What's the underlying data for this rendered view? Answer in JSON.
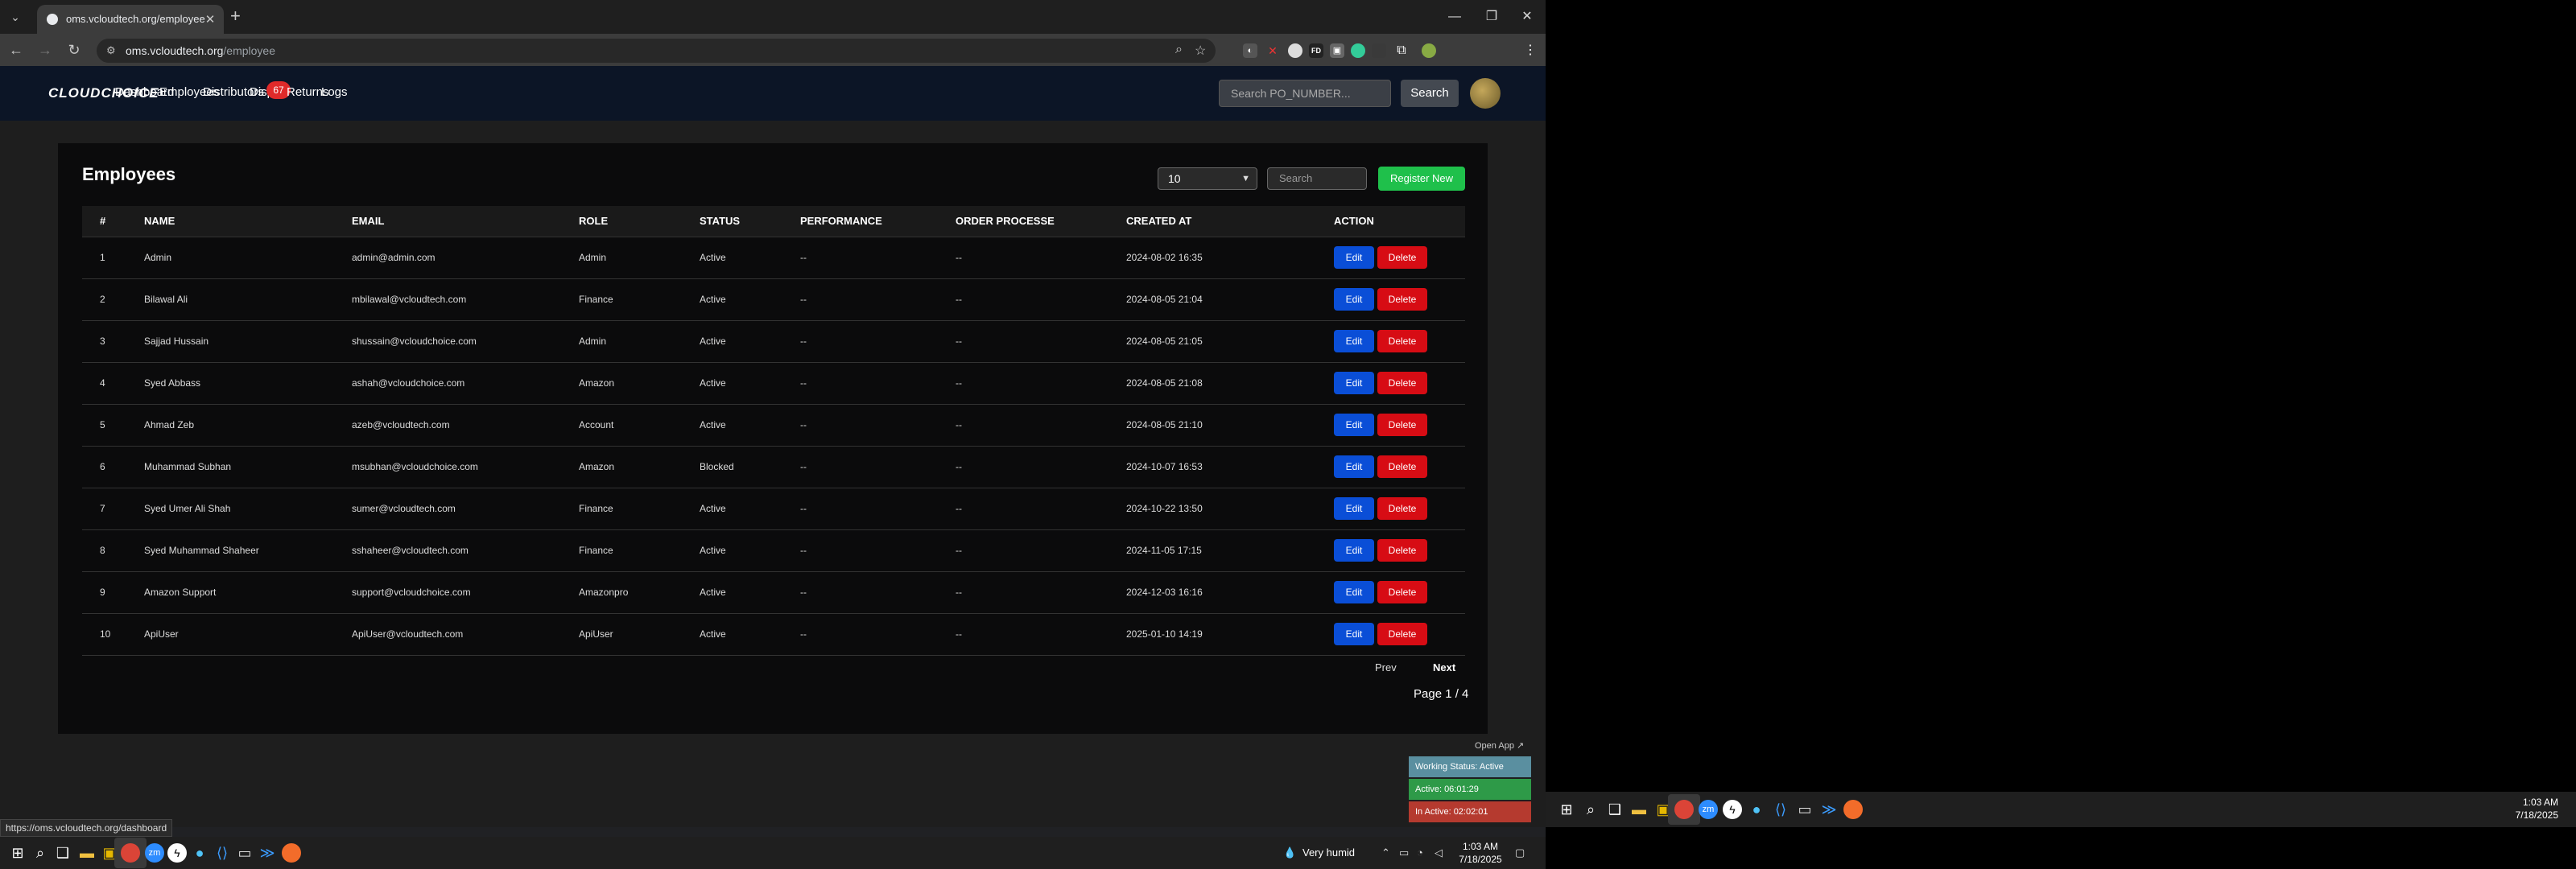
{
  "browser": {
    "tab_title": "oms.vcloudtech.org/employee",
    "url_host": "oms.vcloudtech.org",
    "url_path": "/employee",
    "status_url": "https://oms.vcloudtech.org/dashboard"
  },
  "site_nav": {
    "brand": "CLOUDCHOICE",
    "links": [
      "Dashboard",
      "Employees",
      "Distributors",
      "Dispu",
      "Returns",
      "Logs"
    ],
    "disputes_badge": "67",
    "search_placeholder": "Search PO_NUMBER...",
    "search_button": "Search"
  },
  "employees_page": {
    "title": "Employees",
    "page_size": "10",
    "search_placeholder": "Search",
    "register_button": "Register New",
    "columns": [
      "#",
      "NAME",
      "EMAIL",
      "ROLE",
      "STATUS",
      "PERFORMANCE",
      "ORDER PROCESSE",
      "CREATED AT",
      "ACTION"
    ],
    "edit_label": "Edit",
    "delete_label": "Delete",
    "rows": [
      [
        "1",
        "Admin",
        "admin@admin.com",
        "Admin",
        "Active",
        "--",
        "--",
        "2024-08-02 16:35"
      ],
      [
        "2",
        "Bilawal Ali",
        "mbilawal@vcloudtech.com",
        "Finance",
        "Active",
        "--",
        "--",
        "2024-08-05 21:04"
      ],
      [
        "3",
        "Sajjad Hussain",
        "shussain@vcloudchoice.com",
        "Admin",
        "Active",
        "--",
        "--",
        "2024-08-05 21:05"
      ],
      [
        "4",
        "Syed Abbass",
        "ashah@vcloudchoice.com",
        "Amazon",
        "Active",
        "--",
        "--",
        "2024-08-05 21:08"
      ],
      [
        "5",
        "Ahmad Zeb",
        "azeb@vcloudtech.com",
        "Account",
        "Active",
        "--",
        "--",
        "2024-08-05 21:10"
      ],
      [
        "6",
        "Muhammad Subhan",
        "msubhan@vcloudchoice.com",
        "Amazon",
        "Blocked",
        "--",
        "--",
        "2024-10-07 16:53"
      ],
      [
        "7",
        "Syed Umer Ali Shah",
        "sumer@vcloudtech.com",
        "Finance",
        "Active",
        "--",
        "--",
        "2024-10-22 13:50"
      ],
      [
        "8",
        "Syed Muhammad Shaheer",
        "sshaheer@vcloudtech.com",
        "Finance",
        "Active",
        "--",
        "--",
        "2024-11-05 17:15"
      ],
      [
        "9",
        "Amazon Support",
        "support@vcloudchoice.com",
        "Amazonpro",
        "Active",
        "--",
        "--",
        "2024-12-03 16:16"
      ],
      [
        "10",
        "ApiUser",
        "ApiUser@vcloudtech.com",
        "ApiUser",
        "Active",
        "--",
        "--",
        "2025-01-10 14:19"
      ]
    ],
    "prev_label": "Prev",
    "next_label": "Next",
    "page_indicator": "Page 1 / 4"
  },
  "work_status": {
    "open_app": "Open App ↗",
    "status": "Working Status: Active",
    "active": "Active: 06:01:29",
    "inactive": "In Active: 02:02:01"
  },
  "taskbar": {
    "weather": "Very humid",
    "time": "1:03 AM",
    "date": "7/18/2025"
  },
  "colors": {
    "register_green": "#1fc04b",
    "edit_blue": "#0a4ed7",
    "delete_red": "#d70c14",
    "nav_bg": "#0c1526"
  }
}
